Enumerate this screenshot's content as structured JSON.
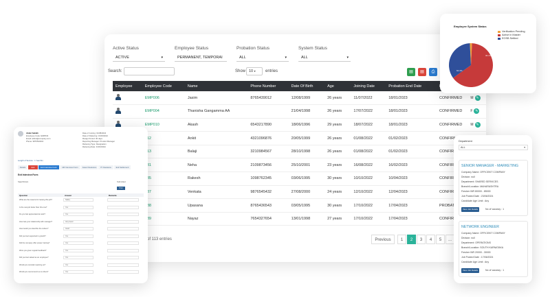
{
  "filters": [
    {
      "label": "Active Status",
      "value": "ACTIVE"
    },
    {
      "label": "Employee Status",
      "value": "PERMANENT, TEMPORAI"
    },
    {
      "label": "Probation Status",
      "value": "ALL"
    },
    {
      "label": "System Status",
      "value": "ALL"
    }
  ],
  "search_label": "Search:",
  "show_label": "Show",
  "show_value": "10",
  "entries_label": "entries",
  "columns": [
    "Employee",
    "Employee Code",
    "Name",
    "Phone Number",
    "Date Of Birth",
    "Age",
    "Joining Date",
    "Probation End Date",
    "Probation C"
  ],
  "rows": [
    {
      "code": "EMP006",
      "name": "Jasim",
      "phone": "8765439012",
      "dob": "12/08/1999",
      "age": "26 years",
      "join": "11/07/2022",
      "end": "18/01/2023",
      "status": "CONFIRMED",
      "extra": "M",
      "avatar": true
    },
    {
      "code": "EMP004",
      "name": "Thanisha Gangamma AA",
      "phone": "",
      "dob": "21/04/1998",
      "age": "26 years",
      "join": "17/07/2022",
      "end": "18/01/2023",
      "status": "CONFIRMED",
      "extra": "F",
      "avatar": true
    },
    {
      "code": "EMP010",
      "name": "Akash",
      "phone": "6543217890",
      "dob": "18/06/1996",
      "age": "29 years",
      "join": "18/07/2022",
      "end": "18/01/2023",
      "status": "CONFIRMED",
      "extra": "M",
      "avatar": true
    },
    {
      "code": "012",
      "name": "Ankit",
      "phone": "4321096876",
      "dob": "20/05/1999",
      "age": "26 years",
      "join": "01/08/2022",
      "end": "01/02/2023",
      "status": "CONFIRMED",
      "extra": "",
      "avatar": false
    },
    {
      "code": "013",
      "name": "Balaji",
      "phone": "3210984567",
      "dob": "28/10/1998",
      "age": "26 years",
      "join": "01/08/2022",
      "end": "01/02/2023",
      "status": "CONFIRMED",
      "extra": "",
      "avatar": false
    },
    {
      "code": "031",
      "name": "Neha",
      "phone": "2109873456",
      "dob": "25/10/2001",
      "age": "23 years",
      "join": "16/08/2022",
      "end": "16/02/2023",
      "status": "CONFIRMED",
      "extra": "",
      "avatar": false
    },
    {
      "code": "035",
      "name": "Rakesh",
      "phone": "1098762345",
      "dob": "03/06/1995",
      "age": "30 years",
      "join": "10/10/2022",
      "end": "10/04/2023",
      "status": "CONFIRMED",
      "extra": "",
      "avatar": false
    },
    {
      "code": "037",
      "name": "Venkata",
      "phone": "9876545432",
      "dob": "27/08/2000",
      "age": "24 years",
      "join": "12/10/2022",
      "end": "12/04/2023",
      "status": "CONFIRMED",
      "extra": "",
      "avatar": false
    },
    {
      "code": "038",
      "name": "Upasana",
      "phone": "8765436543",
      "dob": "03/05/1995",
      "age": "30 years",
      "join": "17/10/2022",
      "end": "17/04/2023",
      "status": "PROBATION",
      "extra": "",
      "avatar": false
    },
    {
      "code": "039",
      "name": "Nayaz",
      "phone": "7654327654",
      "dob": "13/01/1998",
      "age": "27 years",
      "join": "17/10/2022",
      "end": "17/04/2023",
      "status": "CONFIRMED",
      "extra": "",
      "avatar": false
    }
  ],
  "footer_text": "of 113 entries",
  "pagination": {
    "previous": "Previous",
    "pages": [
      "1",
      "2",
      "3",
      "4",
      "5",
      "..."
    ],
    "current": "2"
  },
  "chart_card": {
    "title": "Employee System Status",
    "chart_data": {
      "type": "pie",
      "title": "Employee System Status",
      "categories": [
        "Verification Pending",
        "Active in Master",
        "EOSB Settled"
      ],
      "values": [
        1.6,
        64.3,
        34.1
      ],
      "colors": [
        "#f2a33c",
        "#c63a3a",
        "#2f4f9a"
      ],
      "data_labels": [
        "34.1%",
        "64.3%"
      ],
      "legend_position": "top-right"
    }
  },
  "form_card": {
    "header": [
      "Abdul Sabikh",
      "Employee Code: EMP034",
      "Email: abdul@company.com",
      "Phone: 9876543210"
    ],
    "info": [
      "Date of Joining: 01/08/2022",
      "Date of Relieving: 31/03/2024",
      "Resign Period: 30 days",
      "Reporting Manager: Product Manager",
      "Relieving Type: Resignation",
      "Relieving Date: 31/03/2024"
    ],
    "notice": "Length of Service : 1 Year 8m",
    "tabs": [
      "Details",
      "Exit",
      "Exit Interview Form",
      "HR Interview Form",
      "Asset Clearance",
      "IT Clearance",
      "Exit Settlement"
    ],
    "section": "Exit Interview Form",
    "submitter_name": "Saad Nizam",
    "submitted": "Submitted",
    "print": "Print",
    "col_headers": [
      "Question",
      "Answer",
      "Remarks"
    ],
    "questions": [
      {
        "q": "What are the reasons for leaving this job?",
        "a": "Salary"
      },
      {
        "q": "Is the new job better than this one?",
        "a": "Yes"
      },
      {
        "q": "Do you feel appreciated at work?",
        "a": "Yes"
      },
      {
        "q": "How was your relationship with manager?",
        "a": "Very Good"
      },
      {
        "q": "How would you describe the culture?",
        "a": "Good"
      },
      {
        "q": "Did you feel supported in growth?",
        "a": "Yes"
      },
      {
        "q": "Did the company offer proper training?",
        "a": "Yes"
      },
      {
        "q": "Were you given regular feedback?",
        "a": "Yes"
      },
      {
        "q": "Did you feel valued as an employee?",
        "a": "Yes"
      },
      {
        "q": "Would you consider rejoining us?",
        "a": "Yes"
      },
      {
        "q": "Would you recommend us to others?",
        "a": "Yes"
      }
    ]
  },
  "jobs_card": {
    "department_label": "Department",
    "department_value": "ALL",
    "jobs": [
      {
        "title": "SENIOR MANAGER - MARKETING",
        "company": "Company Name: OFFICEKIT COMPANY",
        "division": "Division: null",
        "department": "Department: SHARED SERVICES",
        "branch": "Branch/Location: MAHARASHTRA",
        "exp": "Fresher  INR 80000 - 85000",
        "posted": "Job Posted Date : 23/06/2024",
        "age": "Candidate Age Limit : Any",
        "button": "View Job Details",
        "vacancy": "No of vacancy : 1"
      },
      {
        "title": "NETWORK ENGINEER",
        "company": "Company Name: OFFICEKIT COMPANY",
        "division": "Division: null",
        "department": "Department: OPERATIONS",
        "branch": "Branch/Location: SOUTH KARNATAKA",
        "exp": "Fresher  INR 20000 - 30000",
        "posted": "Job Posted Date : 17/06/2024",
        "age": "Candidate Age Limit : Any",
        "button": "View Job Details",
        "vacancy": "No of vacancy : 1"
      }
    ]
  }
}
